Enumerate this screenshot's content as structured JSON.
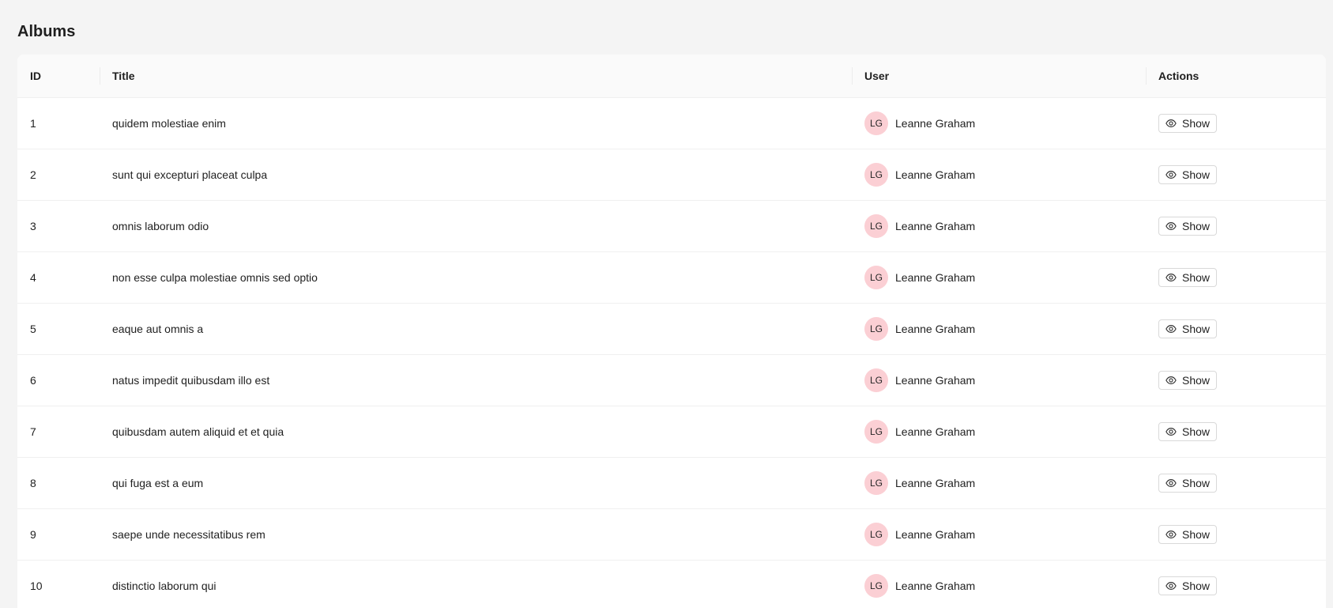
{
  "page": {
    "title": "Albums"
  },
  "table": {
    "columns": [
      "ID",
      "Title",
      "User",
      "Actions"
    ],
    "action_icon": "eye-icon",
    "avatar_color": "#fbcfd4",
    "rows": [
      {
        "id": "1",
        "title": "quidem molestiae enim",
        "user_initials": "LG",
        "user_name": "Leanne Graham",
        "action_label": "Show"
      },
      {
        "id": "2",
        "title": "sunt qui excepturi placeat culpa",
        "user_initials": "LG",
        "user_name": "Leanne Graham",
        "action_label": "Show"
      },
      {
        "id": "3",
        "title": "omnis laborum odio",
        "user_initials": "LG",
        "user_name": "Leanne Graham",
        "action_label": "Show"
      },
      {
        "id": "4",
        "title": "non esse culpa molestiae omnis sed optio",
        "user_initials": "LG",
        "user_name": "Leanne Graham",
        "action_label": "Show"
      },
      {
        "id": "5",
        "title": "eaque aut omnis a",
        "user_initials": "LG",
        "user_name": "Leanne Graham",
        "action_label": "Show"
      },
      {
        "id": "6",
        "title": "natus impedit quibusdam illo est",
        "user_initials": "LG",
        "user_name": "Leanne Graham",
        "action_label": "Show"
      },
      {
        "id": "7",
        "title": "quibusdam autem aliquid et et quia",
        "user_initials": "LG",
        "user_name": "Leanne Graham",
        "action_label": "Show"
      },
      {
        "id": "8",
        "title": "qui fuga est a eum",
        "user_initials": "LG",
        "user_name": "Leanne Graham",
        "action_label": "Show"
      },
      {
        "id": "9",
        "title": "saepe unde necessitatibus rem",
        "user_initials": "LG",
        "user_name": "Leanne Graham",
        "action_label": "Show"
      },
      {
        "id": "10",
        "title": "distinctio laborum qui",
        "user_initials": "LG",
        "user_name": "Leanne Graham",
        "action_label": "Show"
      }
    ]
  }
}
